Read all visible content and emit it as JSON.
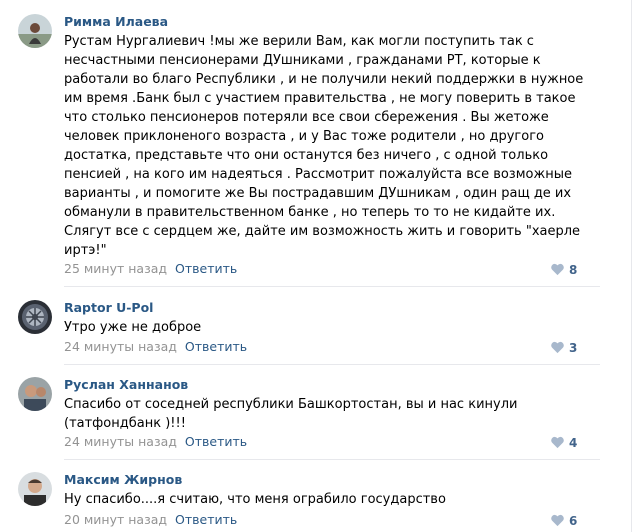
{
  "comments": [
    {
      "author": "Римма Илаева",
      "text": "Рустам Нургалиевич !мы же верили Вам, как могли поступить так с\nнесчастными пенсионерами ДУшниками , гражданами РТ, которые к\nработали во благо Республики , и не получили некий поддержки в нужное\nим время .Банк был с участием правительства , не могу поверить в такое\nчто столько пенсионеров потеряли все свои сбережения . Вы жетоже\nчеловек приклоненого возраста , и у Вас тоже родители , но другого\nдостатка, представьте что они останутся без ничего , с одной только\nпенсией , на кого им надеяться . Рассмотрит пожалуйста все возможные\nварианты , и помогите же Вы пострадавшим ДУшникам , один ращ де их\nобманули в правительственном банке , но теперь то то не кидайте их.\nСлягут все с сердцем же, дайте им возможность жить и говорить \"хаерле\nиртэ!\"",
      "time": "25 минут назад",
      "reply": "Ответить",
      "likes": "8"
    },
    {
      "author": "Raptor U-Pol",
      "text": "Утро уже не доброе",
      "time": "24 минуты назад",
      "reply": "Ответить",
      "likes": "3"
    },
    {
      "author": "Руслан Ханнанов",
      "text": "Спасибо от соседней республики Башкортостан, вы и нас кинули\n(татфондбанк )!!!",
      "time": "24 минуты назад",
      "reply": "Ответить",
      "likes": "4"
    },
    {
      "author": "Максим Жирнов",
      "text": "Ну спасибо....я считаю, что меня ограбило государство",
      "time": "20 минут назад",
      "reply": "Ответить",
      "likes": "6"
    }
  ],
  "icons": {
    "like": "heart-icon"
  },
  "colors": {
    "name": "#2a5885",
    "meta": "#939393",
    "likes": "#42648b",
    "heart": "#a8b8cc",
    "separator": "#e7e8ec"
  }
}
